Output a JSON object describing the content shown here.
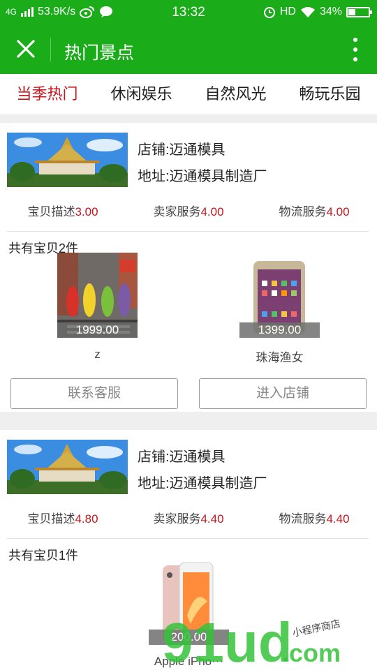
{
  "status_bar": {
    "network": "4G",
    "speed": "53.9K/s",
    "time": "13:32",
    "hd": "HD",
    "battery_text": "34%",
    "battery_level": 0.34,
    "icons": [
      "signal-icon",
      "weibo-icon",
      "message-icon",
      "alarm-icon",
      "wifi-icon",
      "battery-icon"
    ]
  },
  "title_bar": {
    "title": "热门景点",
    "close_icon": "close-icon",
    "more_icon": "more-vertical-icon"
  },
  "tabs": [
    {
      "label": "当季热门",
      "active": true
    },
    {
      "label": "休闲娱乐",
      "active": false
    },
    {
      "label": "自然风光",
      "active": false
    },
    {
      "label": "畅玩乐园",
      "active": false
    }
  ],
  "stores": [
    {
      "name": "店铺:迈通模具",
      "address": "地址:迈通模具制造厂",
      "ratings": [
        {
          "label": "宝贝描述",
          "value": "3.00"
        },
        {
          "label": "卖家服务",
          "value": "4.00"
        },
        {
          "label": "物流服务",
          "value": "4.00"
        }
      ],
      "count_text": "共有宝贝2件",
      "products": [
        {
          "price": "1999.00",
          "name": "z"
        },
        {
          "price": "1399.00",
          "name": "珠海渔女"
        }
      ],
      "buttons": {
        "contact": "联系客服",
        "enter": "进入店铺"
      }
    },
    {
      "name": "店铺:迈通模具",
      "address": "地址:迈通模具制造厂",
      "ratings": [
        {
          "label": "宝贝描述",
          "value": "4.80"
        },
        {
          "label": "卖家服务",
          "value": "4.40"
        },
        {
          "label": "物流服务",
          "value": "4.40"
        }
      ],
      "count_text": "共有宝贝1件",
      "products": [
        {
          "price": "200.00",
          "name": "Apple iPho⋯"
        }
      ]
    }
  ],
  "watermark": {
    "text_main": "91ud",
    "text_domain": ".com",
    "text_small": "小程序商店"
  },
  "colors": {
    "brand_green": "#1aad19",
    "accent_red": "#c8161d"
  }
}
